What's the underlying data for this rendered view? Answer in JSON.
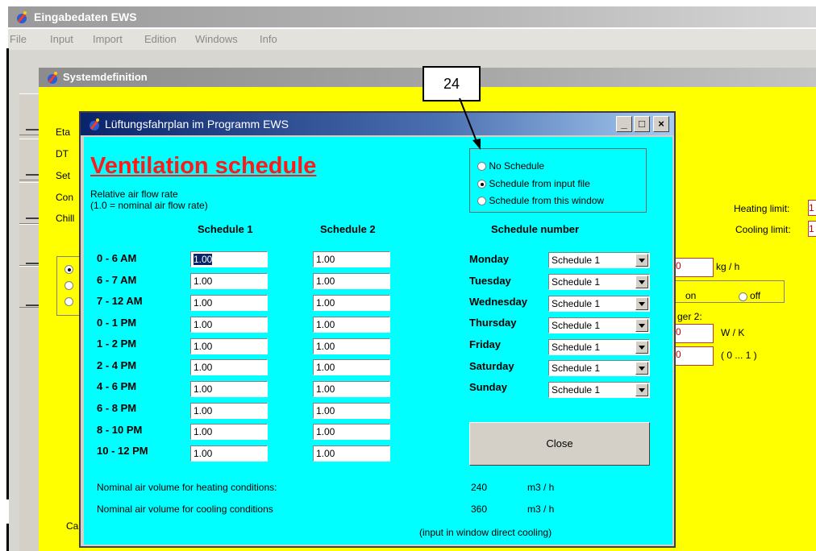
{
  "app": {
    "title": "Eingabedaten EWS",
    "menu": [
      "File",
      "Input",
      "Import",
      "Edition",
      "Windows",
      "Info"
    ]
  },
  "system_window": {
    "title": "Systemdefinition",
    "left_labels": [
      "Eta",
      "DT",
      "Set",
      "Con",
      "Chill"
    ],
    "heating_limit_label": "Heating limit:",
    "cooling_limit_label": "Cooling limit:",
    "heating_limit_value": "1",
    "cooling_limit_value": "1",
    "kg_unit": "kg / h",
    "on_label": "on",
    "off_label": "off",
    "ger_label": "ger 2:",
    "wk_unit": "W / K",
    "range_unit": "( 0 ... 1 )",
    "hidden_value_a": "0",
    "hidden_value_b": "0",
    "hidden_value_c": "0",
    "bottom_label": "Ca"
  },
  "callout": {
    "number": "24"
  },
  "dialog": {
    "title": "Lüftungsfahrplan im Programm EWS",
    "heading": "Ventilation schedule",
    "sub1": "Relative air flow rate",
    "sub2": "(1.0 = nominal air flow rate)",
    "schedule_options": [
      {
        "label": "No Schedule",
        "selected": false
      },
      {
        "label": "Schedule from input file",
        "selected": true
      },
      {
        "label": "Schedule from this window",
        "selected": false
      }
    ],
    "col_schedule1": "Schedule 1",
    "col_schedule2": "Schedule 2",
    "col_schedule_number": "Schedule number",
    "rows": [
      {
        "time": "0  - 6 AM",
        "s1": "1.00",
        "s2": "1.00"
      },
      {
        "time": "6  - 7 AM",
        "s1": "1.00",
        "s2": "1.00"
      },
      {
        "time": "7  - 12 AM",
        "s1": "1.00",
        "s2": "1.00"
      },
      {
        "time": "0 - 1 PM",
        "s1": "1.00",
        "s2": "1.00"
      },
      {
        "time": "1 - 2 PM",
        "s1": "1.00",
        "s2": "1.00"
      },
      {
        "time": "2 - 4 PM",
        "s1": "1.00",
        "s2": "1.00"
      },
      {
        "time": "4 - 6 PM",
        "s1": "1.00",
        "s2": "1.00"
      },
      {
        "time": "6 - 8 PM",
        "s1": "1.00",
        "s2": "1.00"
      },
      {
        "time": "8 - 10 PM",
        "s1": "1.00",
        "s2": "1.00"
      },
      {
        "time": "10 - 12 PM",
        "s1": "1.00",
        "s2": "1.00"
      }
    ],
    "days": [
      {
        "day": "Monday",
        "schedule": "Schedule 1"
      },
      {
        "day": "Tuesday",
        "schedule": "Schedule 1"
      },
      {
        "day": "Wednesday",
        "schedule": "Schedule 1"
      },
      {
        "day": "Thursday",
        "schedule": "Schedule 1"
      },
      {
        "day": "Friday",
        "schedule": "Schedule 1"
      },
      {
        "day": "Saturday",
        "schedule": "Schedule 1"
      },
      {
        "day": "Sunday",
        "schedule": "Schedule 1"
      }
    ],
    "close_label": "Close",
    "heating_label": "Nominal air volume for heating conditions:",
    "heating_value": "240",
    "cooling_label": "Nominal air volume for cooling conditions",
    "cooling_value": "360",
    "unit": "m3 / h",
    "note": "(input in window direct cooling)"
  },
  "colors": {
    "dialog_bg": "#00ffff",
    "system_bg": "#ffff00",
    "heading": "#ff1a1a",
    "titlebar_active": "#0a246a"
  }
}
